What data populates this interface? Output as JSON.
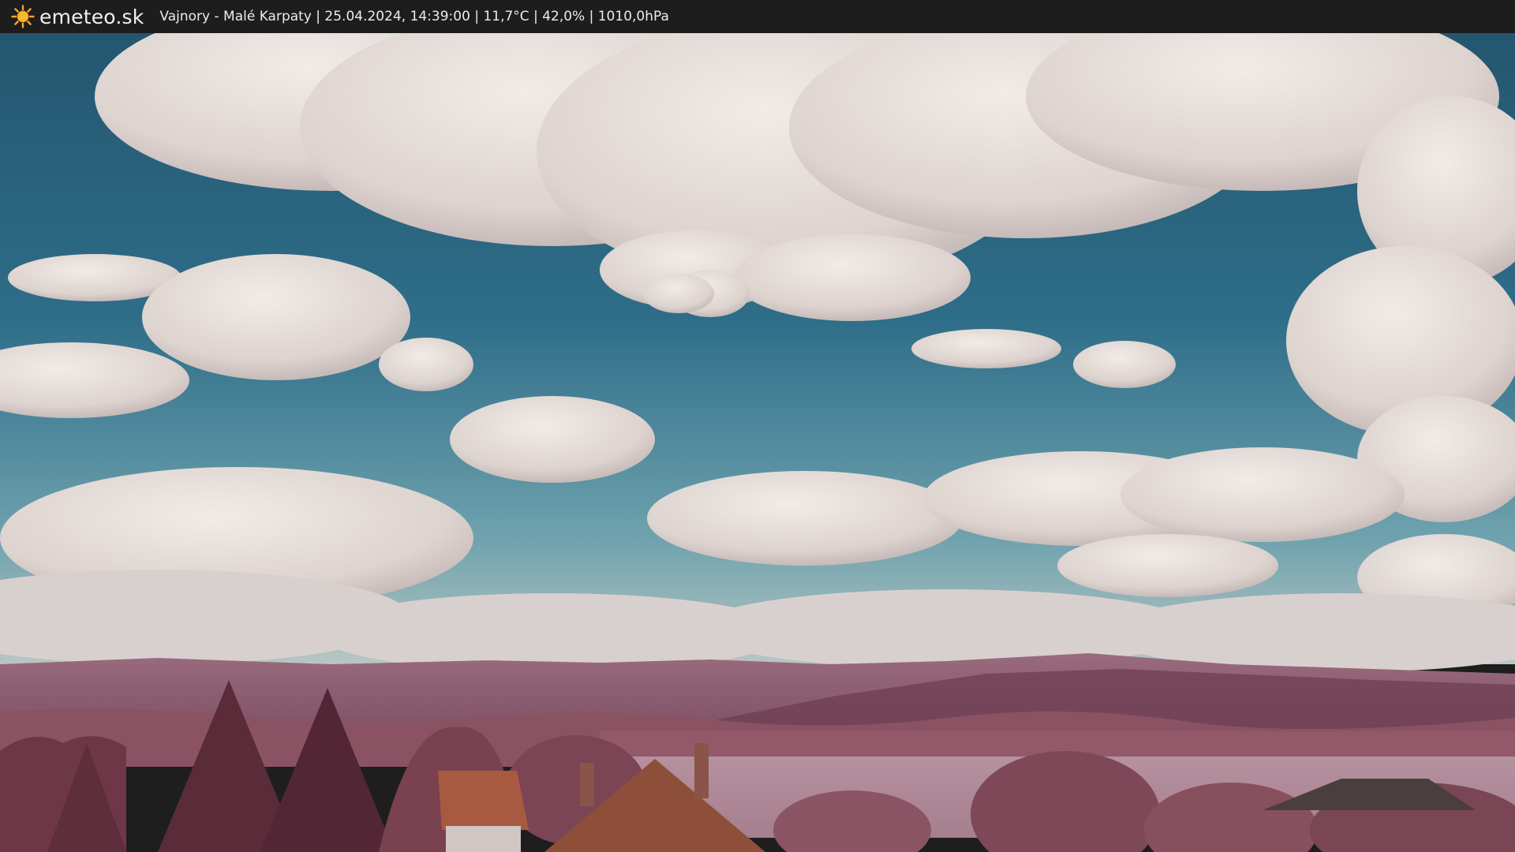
{
  "header": {
    "brand": "emeteo.sk",
    "logo_icon": "sun-icon",
    "caption": "Vajnory - Malé Karpaty | 25.04.2024, 14:39:00 | 11,7°C | 42,0% | 1010,0hPa"
  },
  "colors": {
    "topbar": "#1d1d1d",
    "sun": "#f5a623",
    "sky_top": "#2a5d78",
    "sky_bottom": "#5f98a8",
    "cloud": "#e6dfdc",
    "hills": "#8a5a6e",
    "foliage": "#7c4452",
    "field": "#ad8a97",
    "roof": "#a85a40"
  }
}
